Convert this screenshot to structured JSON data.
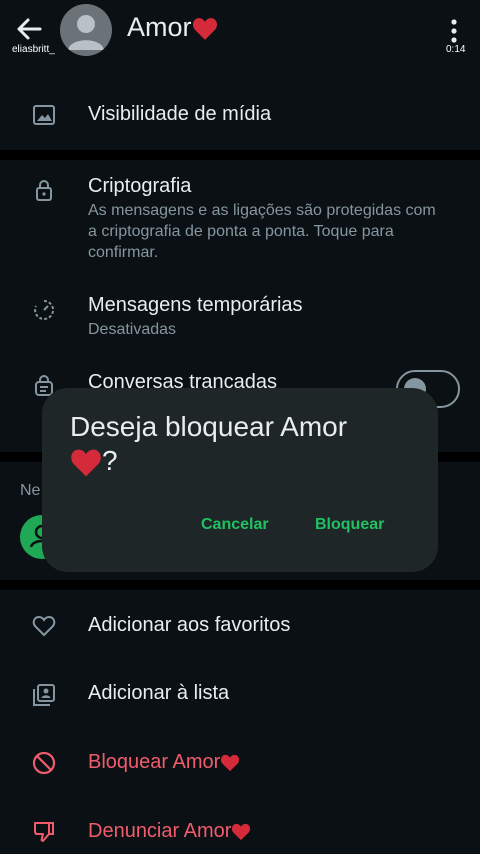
{
  "watermark": {
    "user": "eliasbritt_",
    "time": "0:14"
  },
  "header": {
    "title": "Amor"
  },
  "media": {
    "label": "Visibilidade de mídia"
  },
  "encryption": {
    "title": "Criptografia",
    "description": "As mensagens e as ligações são protegidas com a criptografia de ponta a ponta. Toque para confirmar."
  },
  "disappearing": {
    "title": "Mensagens temporárias",
    "status": "Desativadas"
  },
  "locked_chats": {
    "title": "Conversas trancadas",
    "toggle_on": false
  },
  "groups": {
    "label_partial": "Ne"
  },
  "dialog": {
    "title": "Deseja bloquear Amor",
    "title_suffix": "?",
    "cancel": "Cancelar",
    "confirm": "Bloquear"
  },
  "actions": {
    "favorites": "Adicionar aos favoritos",
    "add_list": "Adicionar à lista",
    "block": "Bloquear Amor",
    "report": "Denunciar Amor"
  },
  "colors": {
    "background": "#0b1014",
    "accent": "#21c063",
    "danger": "#f15c6d",
    "heart": "#d42a3a"
  },
  "icons": {
    "back": "arrow-left-icon",
    "menu": "kebab-menu-icon",
    "media": "image-icon",
    "lock": "lock-icon",
    "timer": "timer-icon",
    "locked_chats": "chat-lock-icon",
    "favorite": "heart-outline-icon",
    "list": "contact-list-icon",
    "block": "block-icon",
    "report": "thumbs-down-icon"
  }
}
